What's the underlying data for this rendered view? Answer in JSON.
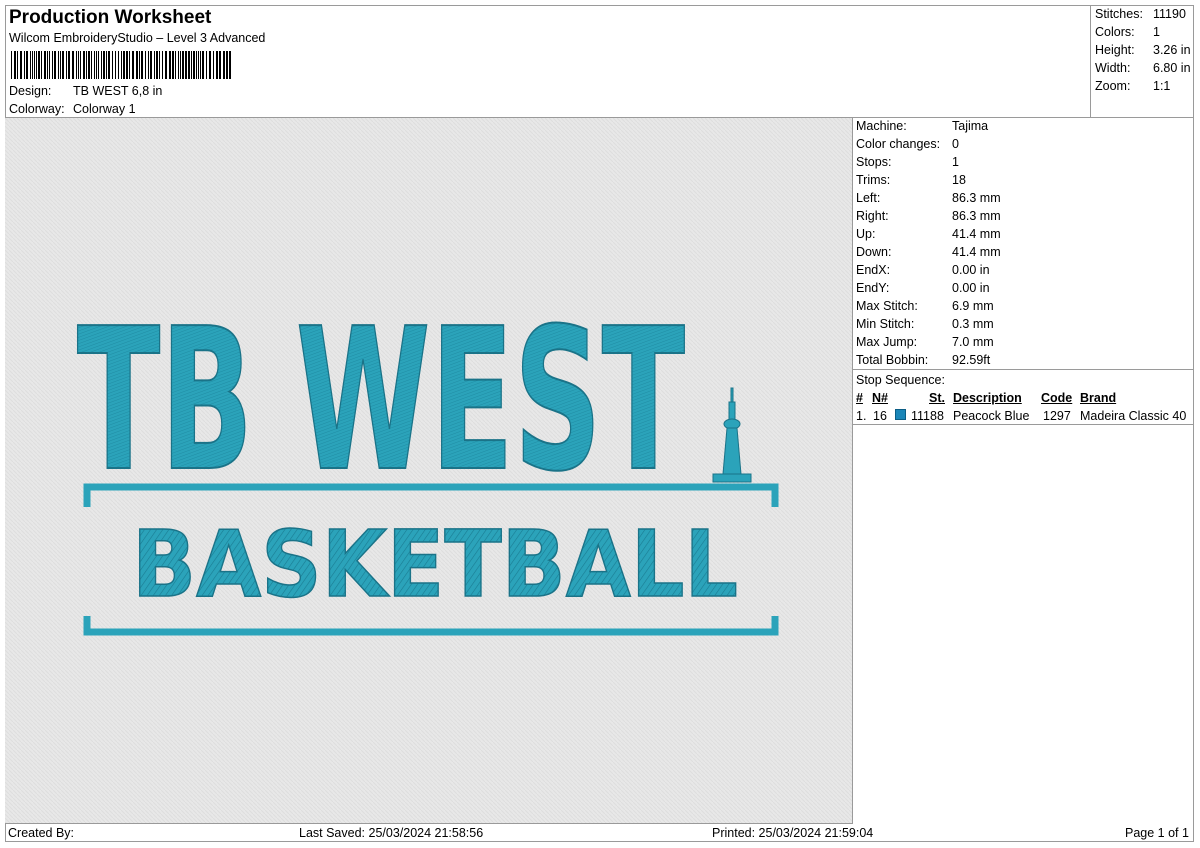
{
  "header": {
    "title": "Production Worksheet",
    "subtitle": "Wilcom EmbroideryStudio – Level 3 Advanced",
    "design_label": "Design:",
    "design_value": "TB WEST 6,8 in",
    "colorway_label": "Colorway:",
    "colorway_value": "Colorway 1"
  },
  "summary": [
    {
      "label": "Stitches:",
      "value": "11190"
    },
    {
      "label": "Colors:",
      "value": "1"
    },
    {
      "label": "Height:",
      "value": "3.26 in"
    },
    {
      "label": "Width:",
      "value": "6.80 in"
    },
    {
      "label": "Zoom:",
      "value": "1:1"
    }
  ],
  "design_preview": {
    "line1": "TB WEST",
    "line2": "BASKETBALL",
    "thread_color": "#2a9fb7",
    "shadow_color": "#1e7f95",
    "fabric_color": "#e8e8e8"
  },
  "machine_info": [
    {
      "label": "Machine:",
      "value": "Tajima"
    },
    {
      "label": "Color changes:",
      "value": "0"
    },
    {
      "label": "Stops:",
      "value": "1"
    },
    {
      "label": "Trims:",
      "value": "18"
    },
    {
      "label": "Left:",
      "value": "86.3 mm"
    },
    {
      "label": "Right:",
      "value": "86.3 mm"
    },
    {
      "label": "Up:",
      "value": "41.4 mm"
    },
    {
      "label": "Down:",
      "value": "41.4 mm"
    },
    {
      "label": "EndX:",
      "value": "0.00 in"
    },
    {
      "label": "EndY:",
      "value": "0.00 in"
    },
    {
      "label": "Max Stitch:",
      "value": "6.9 mm"
    },
    {
      "label": "Min Stitch:",
      "value": "0.3 mm"
    },
    {
      "label": "Max Jump:",
      "value": "7.0 mm"
    },
    {
      "label": "Total Bobbin:",
      "value": "92.59ft"
    }
  ],
  "stop_sequence": {
    "title": "Stop Sequence:",
    "columns": {
      "num": "#",
      "needle": "N#",
      "stitches": "St.",
      "description": "Description",
      "code": "Code",
      "brand": "Brand"
    },
    "rows": [
      {
        "num": "1.",
        "needle": "16",
        "stitches": "11188",
        "description": "Peacock Blue",
        "code": "1297",
        "brand": "Madeira Classic 40",
        "color": "#1a86b8"
      }
    ]
  },
  "footer": {
    "created_by": "Created By:",
    "last_saved": "Last Saved: 25/03/2024 21:58:56",
    "printed": "Printed: 25/03/2024 21:59:04",
    "page": "Page 1 of 1"
  }
}
